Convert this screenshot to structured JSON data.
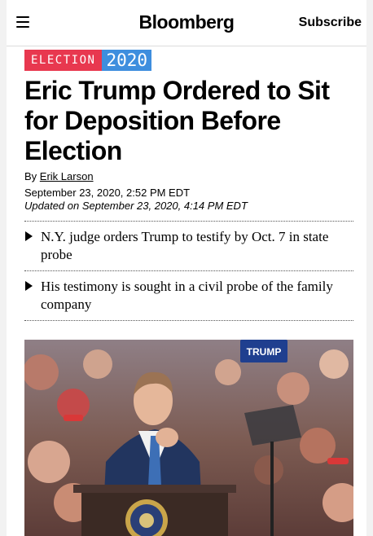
{
  "header": {
    "menu_icon": "hamburger-menu-icon",
    "logo": "Bloomberg",
    "subscribe": "Subscribe"
  },
  "badge": {
    "label": "ELECTION",
    "year": "2020",
    "colors": {
      "label_bg": "#e8384f",
      "year_bg": "#3e8ede"
    }
  },
  "article": {
    "headline": "Eric Trump Ordered to Sit for Deposition Before Election",
    "byline_prefix": "By",
    "author": "Erik Larson",
    "published": "September 23, 2020, 2:52 PM EDT",
    "updated": "Updated on September 23, 2020, 4:14 PM EDT",
    "bullets": [
      "N.Y. judge orders Trump to testify by Oct. 7 in state probe",
      "His testimony is sought in a civil probe of the family company"
    ]
  },
  "photo": {
    "sign_text": "TRUMP"
  }
}
